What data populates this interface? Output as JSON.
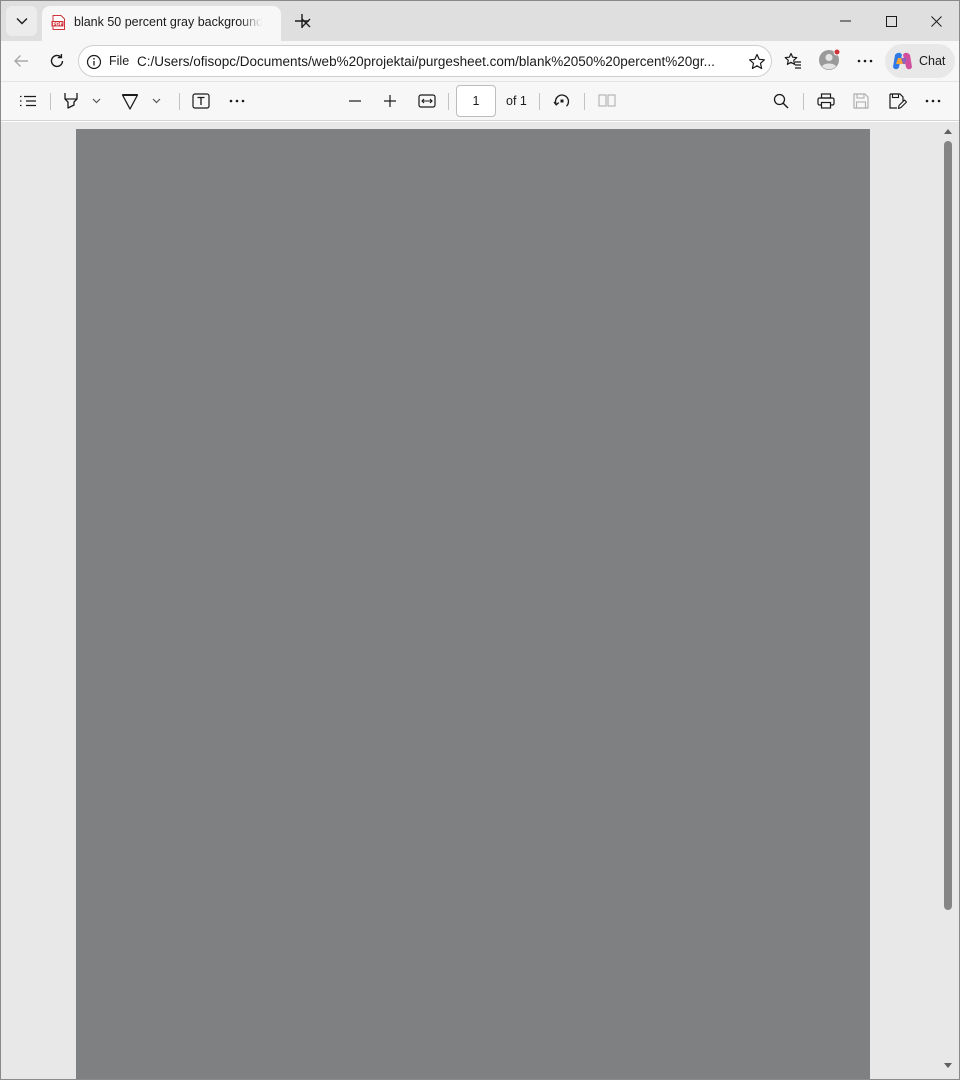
{
  "browser": {
    "tab": {
      "title": "blank 50 percent gray background",
      "favicon": "pdf-file-icon"
    },
    "address_bar": {
      "scheme_label": "File",
      "url": "C:/Users/ofisopc/Documents/web%20projektai/purgesheet.com/blank%2050%20percent%20gr..."
    },
    "chat_label": "Chat",
    "accent_color": "#d13438"
  },
  "pdf_viewer": {
    "current_page": "1",
    "page_count_label": "of 1",
    "page_color": "#7f8082"
  },
  "icons": [
    "tab-actions-icon",
    "pdf-file-icon",
    "close-icon",
    "plus-icon",
    "minimize-icon",
    "maximize-icon",
    "back-icon",
    "refresh-icon",
    "info-icon",
    "star-icon",
    "favorites-icon",
    "profile-icon",
    "more-icon",
    "copilot-icon",
    "contents-icon",
    "highlight-icon",
    "draw-icon",
    "text-icon",
    "zoom-out-icon",
    "zoom-in-icon",
    "fit-width-icon",
    "rotate-icon",
    "page-view-icon",
    "search-icon",
    "print-icon",
    "save-icon",
    "save-as-icon"
  ]
}
